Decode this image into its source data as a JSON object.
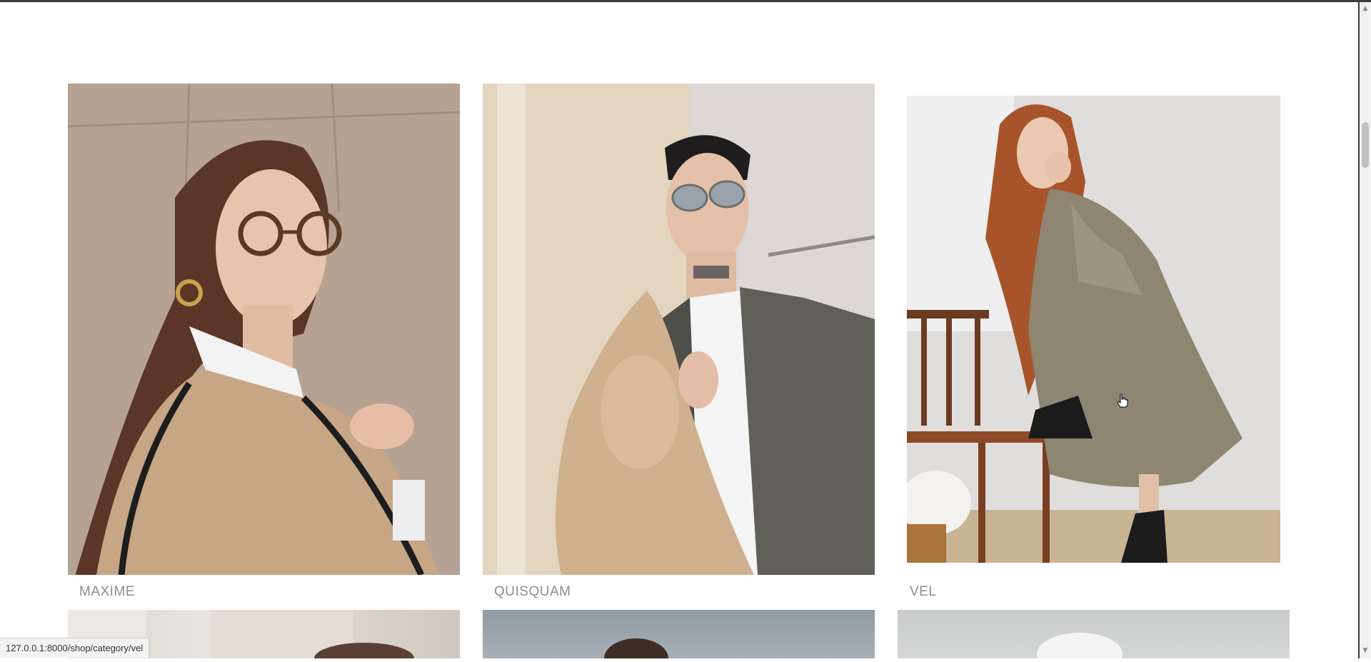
{
  "products": [
    {
      "name": "MAXIME",
      "image_alt": "maxime-photo"
    },
    {
      "name": "QUISQUAM",
      "image_alt": "quisquam-photo"
    },
    {
      "name": "VEL",
      "image_alt": "vel-photo"
    }
  ],
  "status_bar": {
    "url": "127.0.0.1:8000/shop/category/vel"
  },
  "colors": {
    "label_text": "#8e8e8e",
    "page_background": "#ffffff"
  }
}
